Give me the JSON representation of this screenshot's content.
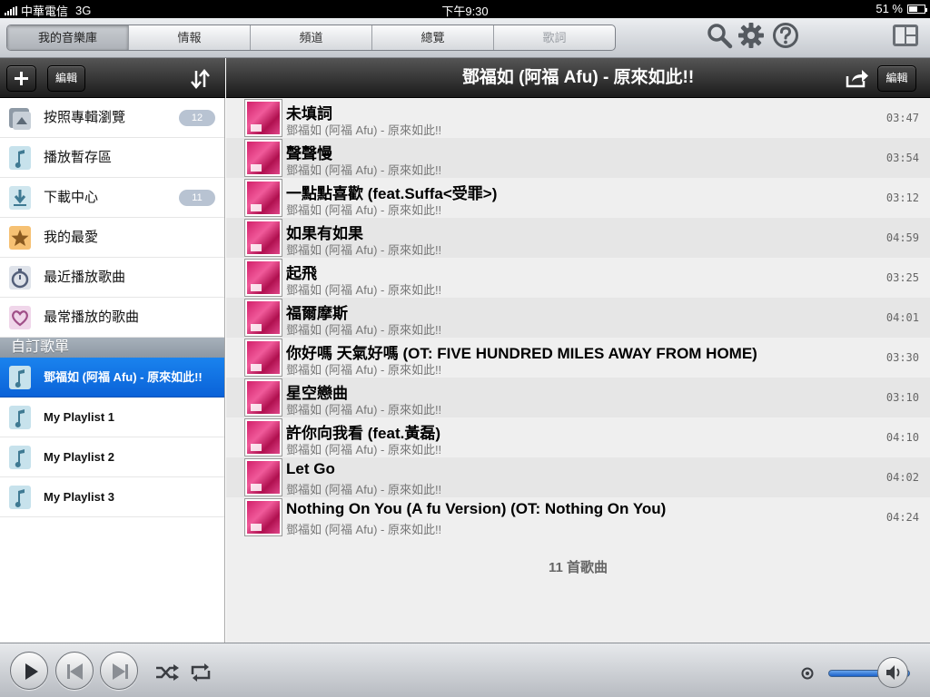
{
  "status": {
    "carrier": "中華電信",
    "network": "3G",
    "time": "下午9:30",
    "battery": "51 %",
    "battery_level": 0.51
  },
  "toolbar": {
    "tabs": [
      {
        "label": "我的音樂庫"
      },
      {
        "label": "情報"
      },
      {
        "label": "頻道"
      },
      {
        "label": "總覽"
      },
      {
        "label": "歌詞"
      }
    ],
    "icons": [
      "search-icon",
      "gear-icon",
      "help-icon",
      "layout-icon"
    ]
  },
  "left": {
    "edit_label": "編輯",
    "items": [
      {
        "label": "按照專輯瀏覽",
        "badge": "12",
        "icon": "album-icon"
      },
      {
        "label": "播放暫存區",
        "icon": "music-note-icon"
      },
      {
        "label": "下載中心",
        "badge": "11",
        "icon": "download-icon"
      },
      {
        "label": "我的最愛",
        "icon": "star-icon"
      },
      {
        "label": "最近播放歌曲",
        "icon": "stopwatch-icon"
      },
      {
        "label": "最常播放的歌曲",
        "icon": "heart-icon"
      }
    ],
    "section_header": "自訂歌單",
    "playlists": [
      {
        "label": "鄧福如 (阿福 Afu) - 原來如此!!"
      },
      {
        "label": "My Playlist 1"
      },
      {
        "label": "My Playlist 2"
      },
      {
        "label": "My Playlist 3"
      }
    ]
  },
  "right": {
    "title": "鄧福如 (阿福 Afu) - 原來如此!!",
    "edit_label": "編輯",
    "songs": [
      {
        "title": "未填詞",
        "artist": "鄧福如 (阿福 Afu) - 原來如此!!",
        "duration": "03:47"
      },
      {
        "title": "聲聲慢",
        "artist": "鄧福如 (阿福 Afu) - 原來如此!!",
        "duration": "03:54"
      },
      {
        "title": "一點點喜歡 (feat.Suffa<受罪>)",
        "artist": "鄧福如 (阿福 Afu) - 原來如此!!",
        "duration": "03:12"
      },
      {
        "title": "如果有如果",
        "artist": "鄧福如 (阿福 Afu) - 原來如此!!",
        "duration": "04:59"
      },
      {
        "title": "起飛",
        "artist": "鄧福如 (阿福 Afu) - 原來如此!!",
        "duration": "03:25"
      },
      {
        "title": "福爾摩斯",
        "artist": "鄧福如 (阿福 Afu) - 原來如此!!",
        "duration": "04:01"
      },
      {
        "title": "你好嗎 天氣好嗎 (OT: FIVE HUNDRED MILES AWAY FROM HOME)",
        "artist": "鄧福如 (阿福 Afu) - 原來如此!!",
        "duration": "03:30"
      },
      {
        "title": "星空戀曲",
        "artist": "鄧福如 (阿福 Afu) - 原來如此!!",
        "duration": "03:10"
      },
      {
        "title": "許你向我看 (feat.黃磊)",
        "artist": "鄧福如 (阿福 Afu) - 原來如此!!",
        "duration": "04:10"
      },
      {
        "title": "Let Go",
        "artist": "鄧福如 (阿福 Afu) - 原來如此!!",
        "duration": "04:02"
      },
      {
        "title": "Nothing On You (A fu Version) (OT: Nothing On You)",
        "artist": "鄧福如 (阿福 Afu) - 原來如此!!",
        "duration": "04:24"
      }
    ],
    "song_count": "11 首歌曲"
  },
  "player": {
    "volume_level": 0.85
  }
}
